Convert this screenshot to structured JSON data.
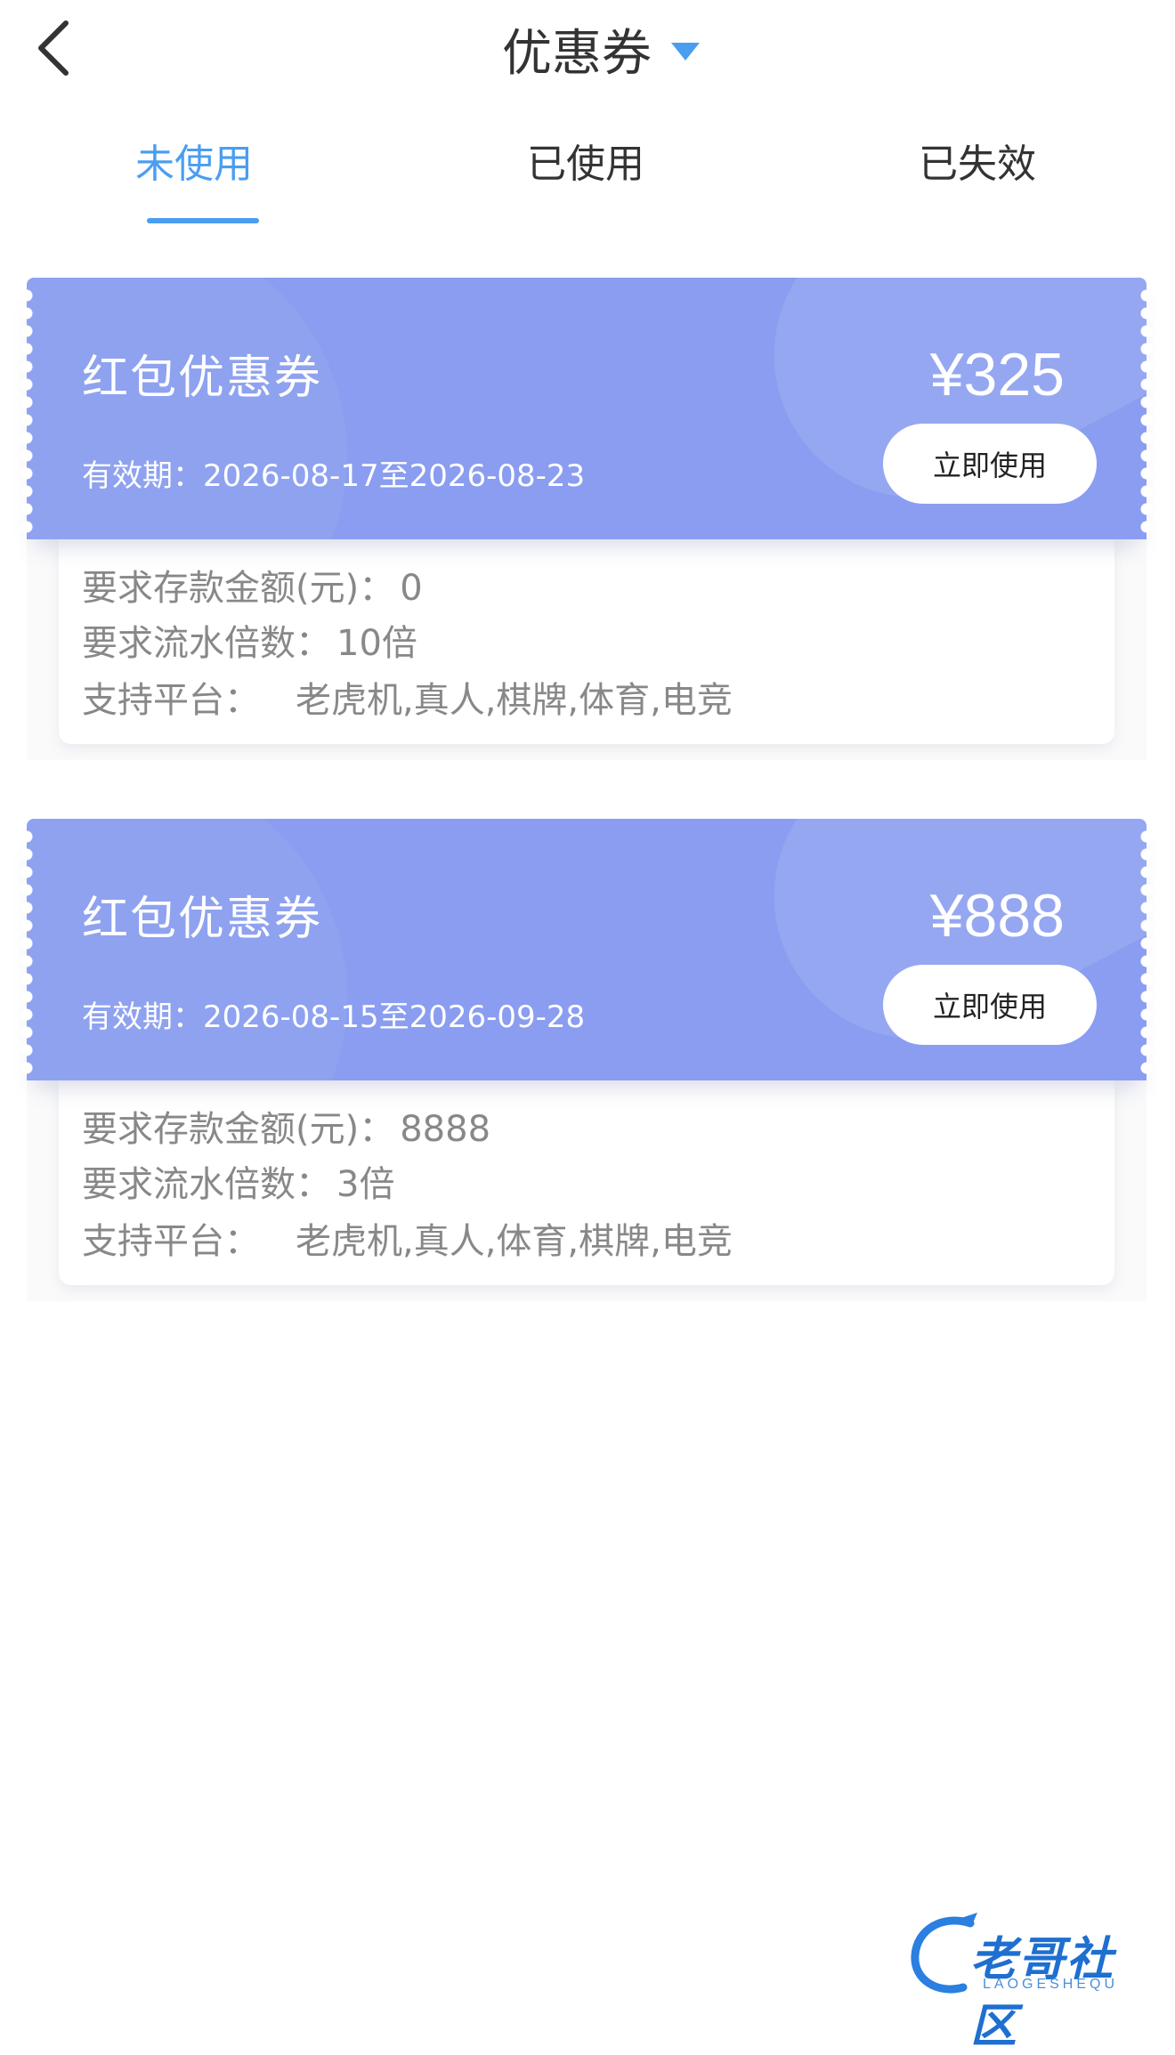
{
  "header": {
    "title": "优惠券",
    "back_icon": "chevron-left-icon",
    "caret_icon": "caret-down-icon"
  },
  "tabs": [
    {
      "label": "未使用",
      "active": true
    },
    {
      "label": "已使用",
      "active": false
    },
    {
      "label": "已失效",
      "active": false
    }
  ],
  "colors": {
    "accent": "#4a9ef0",
    "card": "#8a9df0",
    "muted_text": "#888888"
  },
  "coupons": [
    {
      "name": "红包优惠券",
      "amount": "¥325",
      "validity": "有效期：2026-08-17至2026-08-23",
      "use_label": "立即使用",
      "deposit_label": "要求存款金额(元)：",
      "deposit_value": "0",
      "turnover_label": "要求流水倍数：",
      "turnover_value": "10倍",
      "platform_label": "支持平台：",
      "platform_value": "老虎机,真人,棋牌,体育,电竞"
    },
    {
      "name": "红包优惠券",
      "amount": "¥888",
      "validity": "有效期：2026-08-15至2026-09-28",
      "use_label": "立即使用",
      "deposit_label": "要求存款金额(元)：",
      "deposit_value": "8888",
      "turnover_label": "要求流水倍数：",
      "turnover_value": "3倍",
      "platform_label": "支持平台：",
      "platform_value": "老虎机,真人,体育,棋牌,电竞"
    }
  ],
  "watermark": {
    "text": "老哥社区",
    "sub": "LAOGESHEQU"
  }
}
